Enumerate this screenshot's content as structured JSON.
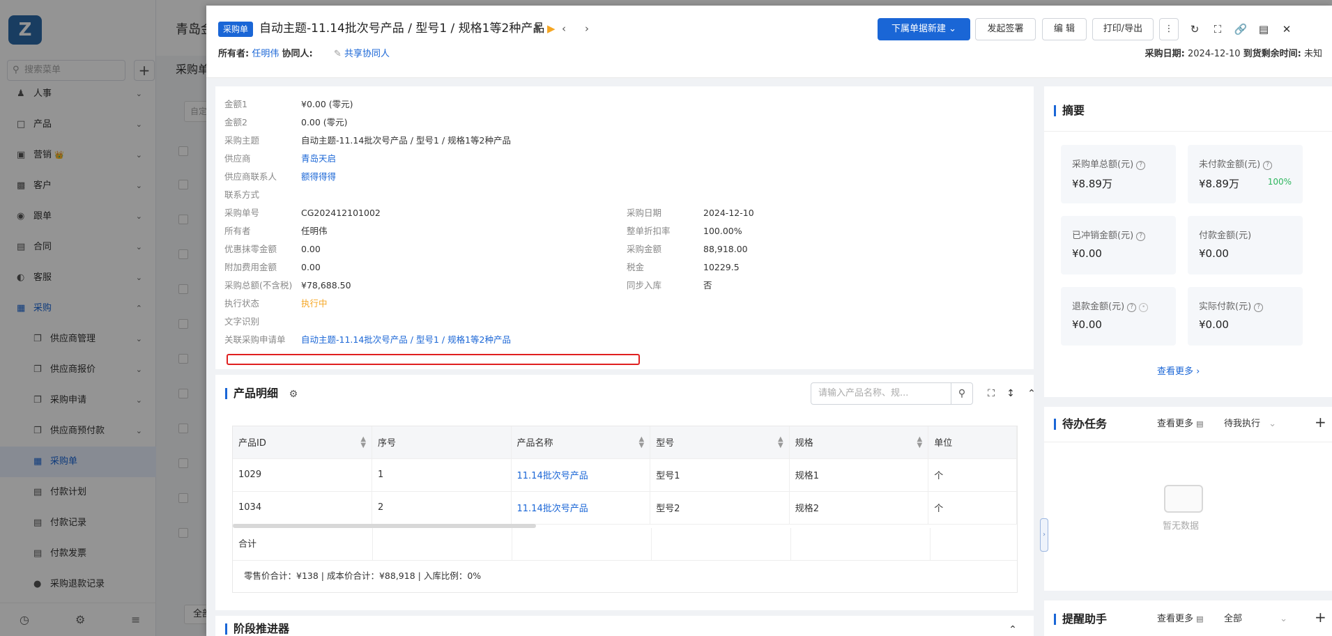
{
  "sidebar": {
    "search_placeholder": "搜索菜单",
    "items": [
      {
        "label": "人事",
        "icon": "people-icon"
      },
      {
        "label": "产品",
        "icon": "cube-icon"
      },
      {
        "label": "营销",
        "icon": "marketing-icon"
      },
      {
        "label": "客户",
        "icon": "customer-icon"
      },
      {
        "label": "跟单",
        "icon": "follow-icon"
      },
      {
        "label": "合同",
        "icon": "contract-icon"
      },
      {
        "label": "客服",
        "icon": "service-icon"
      },
      {
        "label": "采购",
        "icon": "purchase-icon"
      }
    ],
    "subitems": [
      {
        "label": "供应商管理"
      },
      {
        "label": "供应商报价"
      },
      {
        "label": "采购申请"
      },
      {
        "label": "供应商预付款"
      },
      {
        "label": "采购单"
      },
      {
        "label": "付款计划"
      },
      {
        "label": "付款记录"
      },
      {
        "label": "付款发票"
      },
      {
        "label": "采购退款记录"
      }
    ],
    "crown": "👑"
  },
  "background": {
    "company": "青岛金",
    "tab": "采购单",
    "filter_box": "自定",
    "bottom_box": "全部"
  },
  "header": {
    "badge": "采购单",
    "title": "自动主题-11.14批次号产品 / 型号1 / 规格1等2种产品",
    "buttons": {
      "new_sub": "下属单据新建",
      "sign": "发起签署",
      "edit": "编 辑",
      "print": "打印/导出"
    },
    "owner_label": "所有者:",
    "owner": "任明伟",
    "collab_label": "协同人:",
    "share": "共享协同人",
    "date_label": "采购日期:",
    "date": "2024-12-10",
    "remain_label": "到货剩余时间:",
    "remain": "未知"
  },
  "info": {
    "fields": [
      {
        "k": "金额1",
        "v": "¥0.00 (零元)"
      },
      {
        "k": "金额2",
        "v": "0.00 (零元)"
      },
      {
        "k": "采购主题",
        "v": "自动主题-11.14批次号产品 / 型号1 / 规格1等2种产品"
      },
      {
        "k": "供应商",
        "v": "青岛天启"
      },
      {
        "k": "供应商联系人",
        "v": "额得得得"
      },
      {
        "k": "联系方式",
        "v": ""
      },
      {
        "k": "采购单号",
        "v": "CG202412101002"
      },
      {
        "k": "所有者",
        "v": "任明伟"
      },
      {
        "k": "优惠抹零金额",
        "v": "0.00"
      },
      {
        "k": "附加费用金额",
        "v": "0.00"
      },
      {
        "k": "采购总额(不含税)",
        "v": "¥78,688.50"
      },
      {
        "k": "执行状态",
        "v": "执行中"
      },
      {
        "k": "文字识别",
        "v": ""
      },
      {
        "k": "关联采购申请单",
        "v": "自动主题-11.14批次号产品 / 型号1 / 规格1等2种产品"
      }
    ],
    "fields_right": [
      {
        "k": "采购日期",
        "v": "2024-12-10"
      },
      {
        "k": "整单折扣率",
        "v": "100.00%"
      },
      {
        "k": "采购金额",
        "v": "88,918.00"
      },
      {
        "k": "税金",
        "v": "10229.5"
      },
      {
        "k": "同步入库",
        "v": "否"
      }
    ]
  },
  "products": {
    "title": "产品明细",
    "search_placeholder": "请输入产品名称、规...",
    "columns": [
      "产品ID",
      "序号",
      "产品名称",
      "型号",
      "规格",
      "单位"
    ],
    "rows": [
      [
        "1029",
        "1",
        "11.14批次号产品",
        "型号1",
        "规格1",
        "个"
      ],
      [
        "1034",
        "2",
        "11.14批次号产品",
        "型号2",
        "规格2",
        "个"
      ]
    ],
    "sum_label": "合计",
    "summary": "零售价合计：¥138 |   成本价合计：¥88,918 |   入库比例：0%"
  },
  "stage": {
    "title": "阶段推进器"
  },
  "summary": {
    "title": "摘要",
    "tiles": [
      {
        "label": "采购单总额(元)",
        "value": "¥8.89万",
        "pct": ""
      },
      {
        "label": "未付款金额(元)",
        "value": "¥8.89万",
        "pct": "100%"
      },
      {
        "label": "已冲销金额(元)",
        "value": "¥0.00",
        "pct": ""
      },
      {
        "label": "付款金额(元)",
        "value": "¥0.00",
        "pct": ""
      },
      {
        "label": "退款金额(元)",
        "value": "¥0.00",
        "pct": ""
      },
      {
        "label": "实际付款(元)",
        "value": "¥0.00",
        "pct": ""
      }
    ],
    "more": "查看更多"
  },
  "todo": {
    "title": "待办任务",
    "more": "查看更多",
    "filter": "待我执行",
    "empty": "暂无数据"
  },
  "reminder": {
    "title": "提醒助手",
    "more": "查看更多",
    "filter": "全部"
  }
}
